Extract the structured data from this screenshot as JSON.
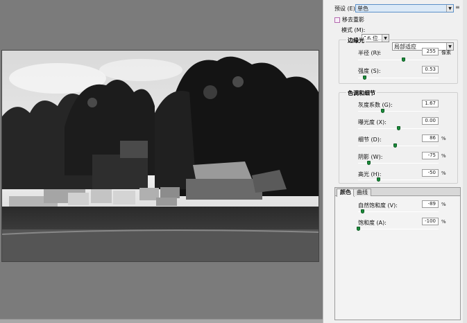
{
  "preset": {
    "label": "预设 (E):",
    "value": "单色"
  },
  "remove_ghost": {
    "label": "移去重影"
  },
  "mode": {
    "label": "模式 (M):",
    "bits": "16 位",
    "method": "局部适应"
  },
  "edge_glow": {
    "title": "边缘光",
    "radius": {
      "label": "半径 (R):",
      "value": "255",
      "unit": "像素",
      "position": 0.56
    },
    "strength": {
      "label": "强度 (S):",
      "value": "0.53",
      "position": 0.08
    }
  },
  "tone_detail": {
    "title": "色调和细节",
    "gamma": {
      "label": "灰度系数 (G):",
      "value": "1.67",
      "position": 0.3
    },
    "exposure": {
      "label": "曝光度 (X):",
      "value": "0.00",
      "position": 0.5
    },
    "detail": {
      "label": "细节 (D):",
      "value": "86",
      "unit": "%",
      "position": 0.46
    },
    "shadow": {
      "label": "阴影 (W):",
      "value": "-75",
      "unit": "%",
      "position": 0.13
    },
    "highlight": {
      "label": "高光 (H):",
      "value": "-50",
      "unit": "%",
      "position": 0.25
    }
  },
  "tabs": [
    "颜色",
    "曲线"
  ],
  "color": {
    "vibrance": {
      "label": "自然饱和度 (V):",
      "value": "-89",
      "unit": "%",
      "position": 0.05
    },
    "saturation": {
      "label": "饱和度 (A):",
      "value": "-100",
      "unit": "%",
      "position": 0.0
    }
  },
  "icons": {
    "menu": "panel-menu-icon",
    "cursor": "hand-pointer-icon"
  }
}
